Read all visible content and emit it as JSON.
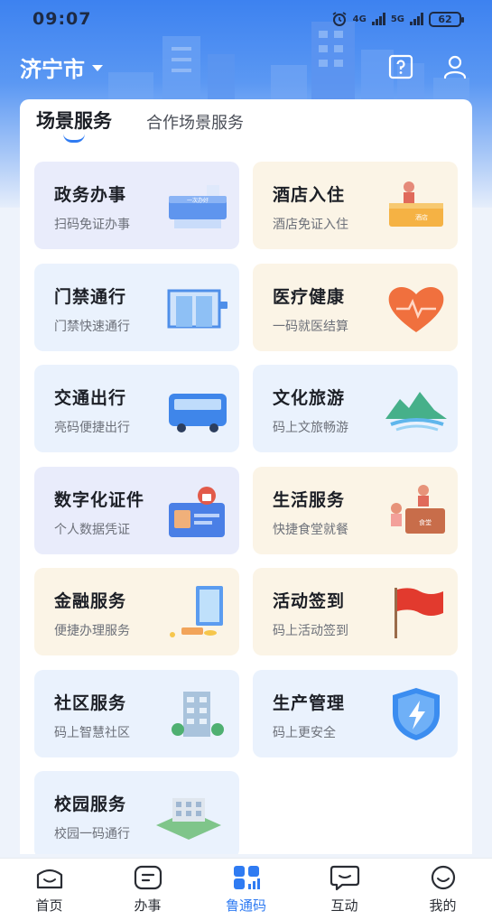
{
  "status_bar": {
    "time": "09:07",
    "network_1": "4G",
    "network_2": "5G",
    "battery": "62",
    "icons": [
      "alarm-icon",
      "signal-icon",
      "battery-icon"
    ]
  },
  "header": {
    "city": "济宁市",
    "icons": [
      "help-icon",
      "profile-icon"
    ]
  },
  "tabs": [
    {
      "label": "场景服务",
      "active": true
    },
    {
      "label": "合作场景服务",
      "active": false
    }
  ],
  "cards": [
    {
      "title": "政务办事",
      "subtitle": "扫码免证办事",
      "icon": "service-counter-icon",
      "art_text": "一次办好"
    },
    {
      "title": "酒店入住",
      "subtitle": "酒店免证入住",
      "icon": "hotel-reception-icon",
      "art_text": "酒店"
    },
    {
      "title": "门禁通行",
      "subtitle": "门禁快速通行",
      "icon": "gate-icon"
    },
    {
      "title": "医疗健康",
      "subtitle": "一码就医结算",
      "icon": "heart-medical-icon"
    },
    {
      "title": "交通出行",
      "subtitle": "亮码便捷出行",
      "icon": "bus-icon"
    },
    {
      "title": "文化旅游",
      "subtitle": "码上文旅畅游",
      "icon": "mountain-icon"
    },
    {
      "title": "数字化证件",
      "subtitle": "个人数据凭证",
      "icon": "id-card-icon"
    },
    {
      "title": "生活服务",
      "subtitle": "快捷食堂就餐",
      "icon": "canteen-icon",
      "art_text": "食堂"
    },
    {
      "title": "金融服务",
      "subtitle": "便捷办理服务",
      "icon": "finance-icon"
    },
    {
      "title": "活动签到",
      "subtitle": "码上活动签到",
      "icon": "flag-icon"
    },
    {
      "title": "社区服务",
      "subtitle": "码上智慧社区",
      "icon": "community-building-icon"
    },
    {
      "title": "生产管理",
      "subtitle": "码上更安全",
      "icon": "shield-lightning-icon"
    },
    {
      "title": "校园服务",
      "subtitle": "校园一码通行",
      "icon": "campus-icon"
    }
  ],
  "bottom_nav": [
    {
      "label": "首页",
      "icon": "home-icon",
      "active": false
    },
    {
      "label": "办事",
      "icon": "tasks-icon",
      "active": false
    },
    {
      "label": "鲁通码",
      "icon": "qr-code-icon",
      "active": true
    },
    {
      "label": "互动",
      "icon": "chat-icon",
      "active": false
    },
    {
      "label": "我的",
      "icon": "smile-icon",
      "active": false
    }
  ],
  "colors": {
    "accent": "#2f7bf2",
    "hero_top": "#3d82f0",
    "card_blue": "#eaf2fd",
    "card_lilac": "#e9ecfb",
    "card_cream": "#fbf4e6"
  }
}
